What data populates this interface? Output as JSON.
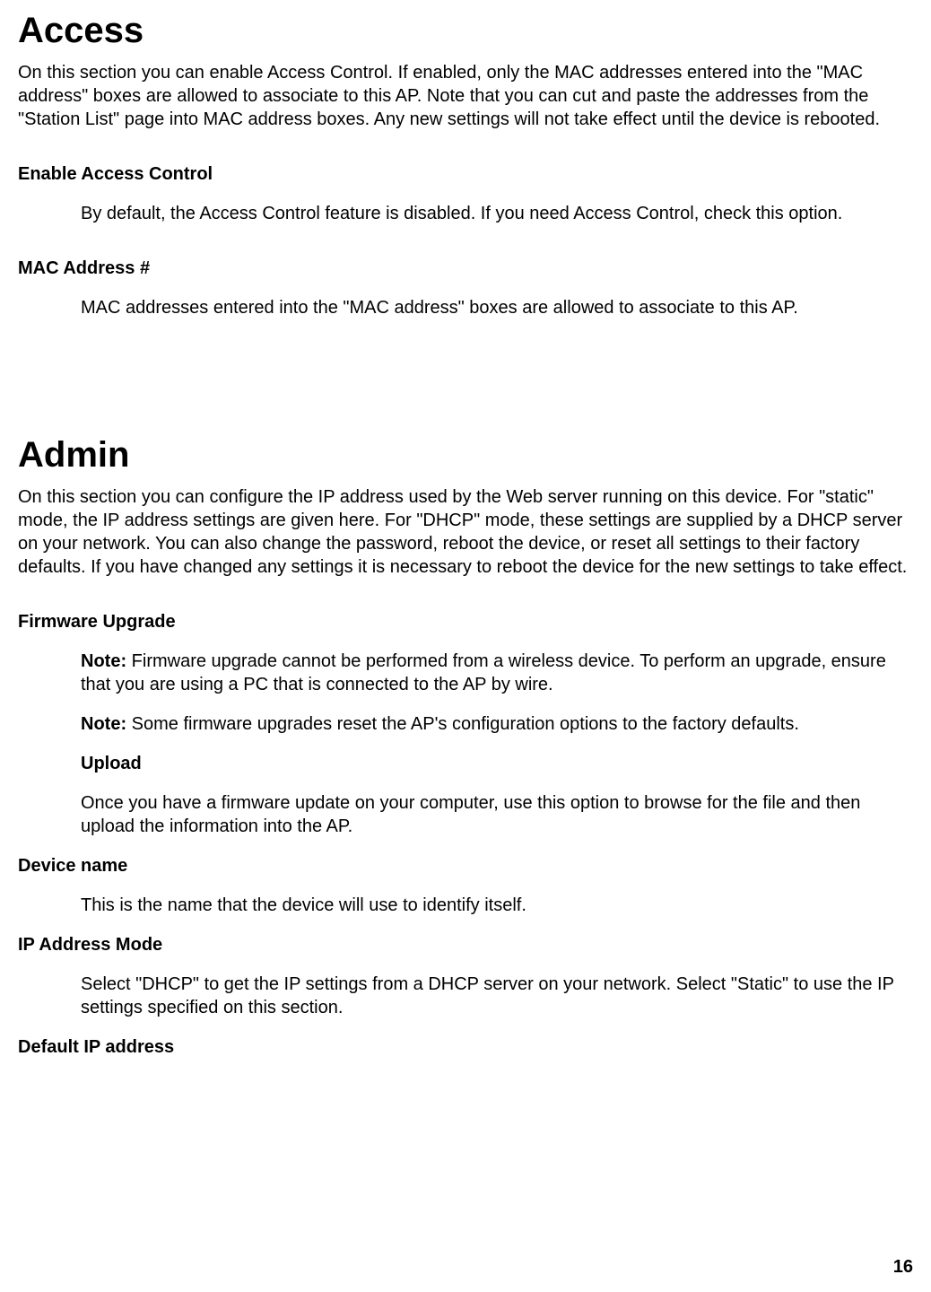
{
  "access": {
    "title": "Access",
    "intro": "On this section you can enable Access Control. If enabled, only the MAC addresses entered into the \"MAC address\" boxes are allowed to associate to this AP. Note that you can cut and paste the addresses from the \"Station List\" page into MAC address boxes. Any new settings will not take effect until the device is rebooted.",
    "enable_label": "Enable Access Control",
    "enable_desc": "By default, the Access Control feature is disabled. If you need Access Control, check this option.",
    "mac_label": "MAC Address #",
    "mac_desc": "MAC addresses entered into the \"MAC address\" boxes are allowed to associate to this AP."
  },
  "admin": {
    "title": "Admin",
    "intro": "On this section you can configure the IP address used by the Web server running on this device. For \"static\" mode, the IP address settings are given here. For \"DHCP\" mode, these settings are supplied by a DHCP server on your network. You can also change the password, reboot the device, or reset all settings to their factory defaults. If you have changed any settings it is necessary to reboot the device for the new settings to take effect.",
    "firmware_label": "Firmware Upgrade",
    "firmware_note1_prefix": "Note:",
    "firmware_note1": " Firmware upgrade cannot be performed from a wireless device. To perform an upgrade, ensure that you are using a PC that is connected to the AP by wire.",
    "firmware_note2_prefix": "Note:",
    "firmware_note2": " Some firmware upgrades reset the AP's configuration options to the factory defaults.",
    "upload_label": "Upload",
    "upload_desc": "Once you have a firmware update on your computer, use this option to browse for the file and then upload the information into the AP.",
    "device_name_label": "Device name",
    "device_name_desc": "This is the name that the device will use to identify itself.",
    "ip_mode_label": "IP Address Mode",
    "ip_mode_desc": "Select \"DHCP\" to get the IP settings from a DHCP server on your network. Select \"Static\" to use the IP settings specified on this section.",
    "default_ip_label": "Default IP address"
  },
  "page_number": "16"
}
